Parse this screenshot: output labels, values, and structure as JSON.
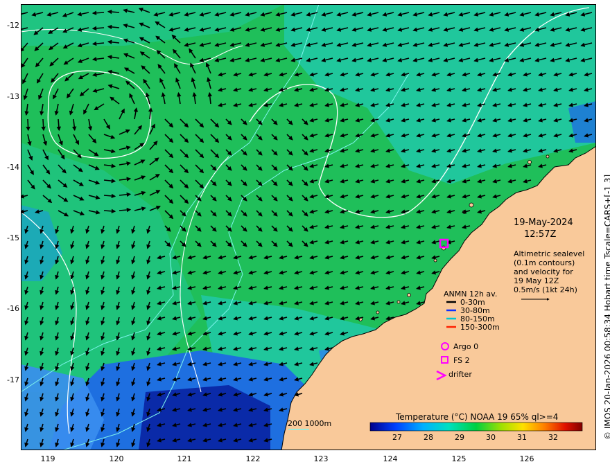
{
  "map": {
    "x_axis_ticks": [
      "119",
      "120",
      "121",
      "122",
      "123",
      "124",
      "125",
      "126"
    ],
    "y_axis_ticks": [
      "-12",
      "-13",
      "-14",
      "-15",
      "-16",
      "-17"
    ],
    "date": "19-May-2024",
    "time": "12:57Z",
    "info_lines": [
      "Altimetric sealevel",
      "(0.1m contours)",
      "and velocity for",
      "19 May 12Z",
      "0.5m/s (1kt 24h)"
    ],
    "legend": {
      "title": "ANMN 12h av.",
      "items": [
        {
          "label": "0-30m",
          "color": "#000000"
        },
        {
          "label": "30-80m",
          "color": "#1030ff"
        },
        {
          "label": "80-150m",
          "color": "#00c8d0"
        },
        {
          "label": "150-300m",
          "color": "#ff2000"
        }
      ]
    },
    "markers": {
      "argo": "Argo 0",
      "fs": "FS 2",
      "drifter": "drifter"
    },
    "depth_label": "200  1000m",
    "colorbar": {
      "title": "Temperature (°C) NOAA 19 65% ql>=4",
      "ticks": [
        "27",
        "28",
        "29",
        "30",
        "31",
        "32"
      ]
    },
    "side_note": "© IMOS 20-Jan-2026 00:58:34 Hobart time Tscale=CARS+[-1 3]",
    "colors": {
      "ocean_green": "#1fbf5a",
      "ocean_teal": "#22c9a8",
      "ocean_blue": "#1e6fe0",
      "deep_blue": "#0a2aa8",
      "land": "#f9c99a",
      "contour": "#ffffff",
      "shelf": "#7ff5ee",
      "marker": "#ff00ff"
    }
  }
}
